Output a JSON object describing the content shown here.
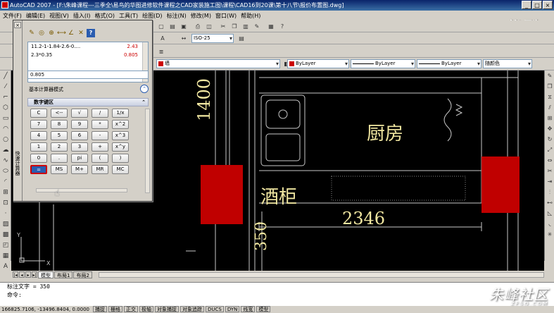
{
  "window": {
    "title": "AutoCAD 2007 - [F:\\朱峰课程---三季全\\易鸟的华图进修软件课程之CAD家装施工图\\课程\\CAD16到20课\\第十八节\\报价布置图.dwg]",
    "buttons": [
      "_",
      "□",
      "×"
    ]
  },
  "menu": [
    "文件(F)",
    "编辑(E)",
    "视图(V)",
    "插入(I)",
    "格式(O)",
    "工具(T)",
    "绘图(D)",
    "标注(N)",
    "修改(M)",
    "窗口(W)",
    "帮助(H)"
  ],
  "watermark_top": "优酷",
  "toolbar": {
    "dimstyle": "ISO-25",
    "layer": "墙",
    "color": "ByLayer",
    "linetype": "ByLayer",
    "lineweight": "ByLayer",
    "plotstyle": "随颜色"
  },
  "quickcalc": {
    "title": "快速计算器",
    "close": "×",
    "history": [
      {
        "expr": "11.2-1-1.84-2.6-0....",
        "result": "2.43"
      },
      {
        "expr": "2.3*0.35",
        "result": "0.805"
      }
    ],
    "input": "0.805",
    "mode_label": "基本计算器模式",
    "numpad_header": "数字键区",
    "keys": [
      "C",
      "<--",
      "√",
      "/",
      "1/x",
      "7",
      "8",
      "9",
      "*",
      "x^2",
      "4",
      "5",
      "6",
      "-",
      "x^3",
      "1",
      "2",
      "3",
      "+",
      "x^y",
      "0",
      ".",
      "pi",
      "(",
      ")",
      "=",
      "MS",
      "M+",
      "MR",
      "MC"
    ]
  },
  "drawing": {
    "labels": {
      "kitchen": "厨房",
      "wine_cabinet": "酒柜",
      "dim_1400": "1400",
      "dim_2346": "2346",
      "dim_350": "350"
    },
    "colors": {
      "background": "#000000",
      "wall_fill": "#c00000",
      "text": "#f0e6a0",
      "dim": "#c8c8c8"
    }
  },
  "layout_tabs": [
    "模型",
    "布局1",
    "布局2"
  ],
  "command": {
    "history": "标注文字 = 350",
    "prompt": "命令:"
  },
  "status": {
    "coords": "166825.7106, -13496.8404, 0.0000",
    "buttons": [
      "捕捉",
      "栅格",
      "正交",
      "极轴",
      "对象捕捉",
      "对象追踪",
      "DUCS",
      "DYN",
      "线宽",
      "模型"
    ]
  },
  "watermark_bottom": {
    "main": "朱峰社区",
    "sub": "ZFSQ.COM"
  }
}
